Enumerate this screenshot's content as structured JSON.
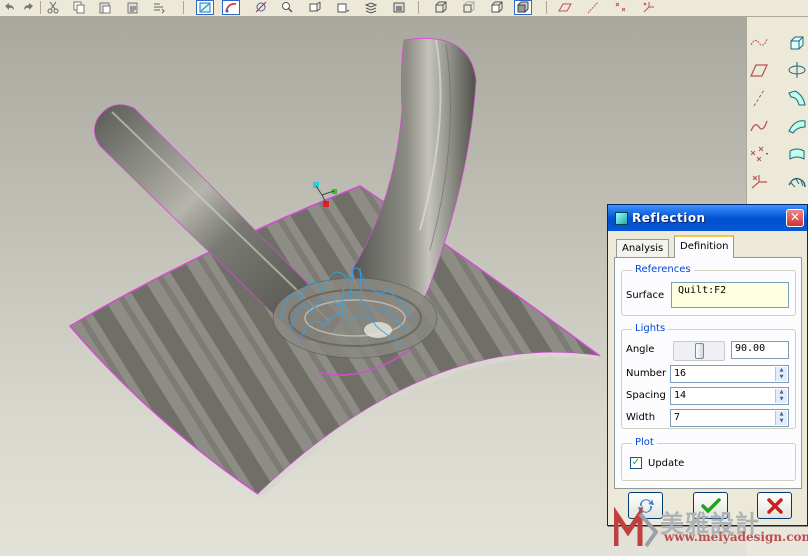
{
  "toolbar": {
    "buttons": [
      {
        "icon": "undo-icon"
      },
      {
        "icon": "redo-icon"
      },
      {
        "icon": "cut-icon"
      },
      {
        "icon": "copy-icon"
      },
      {
        "icon": "paste-icon"
      },
      {
        "icon": "paste-special-icon"
      },
      {
        "icon": "regenerate-icon"
      },
      {
        "icon": "model-tree-icon",
        "active": true
      },
      {
        "icon": "sketch-icon",
        "active": true
      },
      {
        "icon": "view-manager-icon"
      },
      {
        "icon": "zoom-icon"
      },
      {
        "icon": "orient-icon"
      },
      {
        "icon": "saved-views-icon"
      },
      {
        "icon": "layers-icon"
      },
      {
        "icon": "display-style-icon"
      },
      {
        "icon": "wireframe-icon"
      },
      {
        "icon": "hidden-line-icon"
      },
      {
        "icon": "no-hidden-icon"
      },
      {
        "icon": "shading-icon",
        "active": true
      },
      {
        "icon": "datum-planes-icon"
      },
      {
        "icon": "datum-axes-icon"
      },
      {
        "icon": "datum-points-icon"
      },
      {
        "icon": "coordinate-systems-icon"
      }
    ]
  },
  "right_toolbar": {
    "buttons": [
      {
        "icon": "datum-curve-icon"
      },
      {
        "icon": "datum-plane-tool-icon"
      },
      {
        "icon": "datum-axis-tool-icon"
      },
      {
        "icon": "sketched-curve-icon"
      },
      {
        "icon": "datum-point-tool-icon"
      },
      {
        "icon": "coordinate-system-tool-icon"
      },
      {
        "icon": "extrude-icon"
      },
      {
        "icon": "revolve-icon"
      },
      {
        "icon": "sweep-icon"
      },
      {
        "icon": "blend-icon"
      },
      {
        "icon": "boundary-surface-icon"
      }
    ]
  },
  "dialog": {
    "title": "Reflection",
    "close_label": "✕",
    "tabs": [
      {
        "label": "Analysis",
        "selected": false
      },
      {
        "label": "Definition",
        "selected": true
      }
    ],
    "references": {
      "group_title": "References",
      "surface_label": "Surface",
      "surface_value": "Quilt:F2"
    },
    "lights": {
      "group_title": "Lights",
      "angle_label": "Angle",
      "angle_value": "90.00",
      "angle_slider_fraction": 0.5,
      "number_label": "Number",
      "number_value": "16",
      "spacing_label": "Spacing",
      "spacing_value": "14",
      "width_label": "Width",
      "width_value": "7"
    },
    "plot": {
      "group_title": "Plot",
      "update_label": "Update",
      "update_checked": true,
      "check_glyph": "✓"
    },
    "footer_buttons": [
      {
        "name": "compute-button",
        "icon": "repaint-icon"
      },
      {
        "name": "ok-button",
        "icon": "checkmark-icon"
      },
      {
        "name": "cancel-button",
        "icon": "cancel-x-icon"
      }
    ]
  },
  "watermark": {
    "chinese": "美雅設計",
    "url": "www.meiyadesign.com"
  },
  "colors": {
    "accent": "#0a5ad8",
    "group_title": "#0046d5",
    "ref_box": "#ffffe1",
    "surface_edge": "#d24bd2",
    "curves": "#3aa0e0"
  }
}
